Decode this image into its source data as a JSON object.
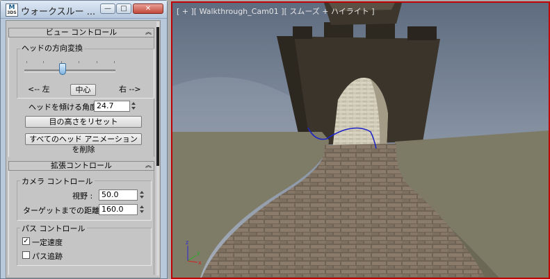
{
  "window": {
    "title": "ウォークスルー ...",
    "icon_text": "M",
    "icon_subtext": "3DS",
    "buttons": {
      "minimize": "—",
      "maximize": "□",
      "close": "✕"
    }
  },
  "view_control": {
    "header": "ビュー コントロール",
    "head_rotation": {
      "group_label": "ヘッドの方向変換",
      "slider_level": 0.42,
      "left_label": "<-- 左",
      "center_button": "中心",
      "right_label": "右 -->"
    },
    "head_tilt_label": "ヘッドを傾ける角度",
    "head_tilt_value": "24.7",
    "reset_eye_height_button": "目の高さをリセット",
    "delete_head_anim_button": "すべてのヘッド アニメーションを削除"
  },
  "advanced_control": {
    "header": "拡張コントロール",
    "camera_group_label": "カメラ コントロール",
    "fov_label": "視野 :",
    "fov_value": "50.0",
    "target_distance_label": "ターゲットまでの距離 :",
    "target_distance_value": "160.0",
    "path_group_label": "パス コントロール",
    "constant_speed_label": "一定速度",
    "constant_speed_checked": true,
    "follow_path_label": "パス追跡",
    "follow_path_checked": false
  },
  "viewport": {
    "label": "[ + ][ Walkthrough_Cam01 ][ スムーズ + ハイライト ]",
    "sky_color": "#7e8b9e",
    "border_color": "#c00000"
  },
  "icons": {
    "rollout_collapse": "double-chevron-up-icon",
    "axis_gizmo": "xyz-axis-icon"
  }
}
